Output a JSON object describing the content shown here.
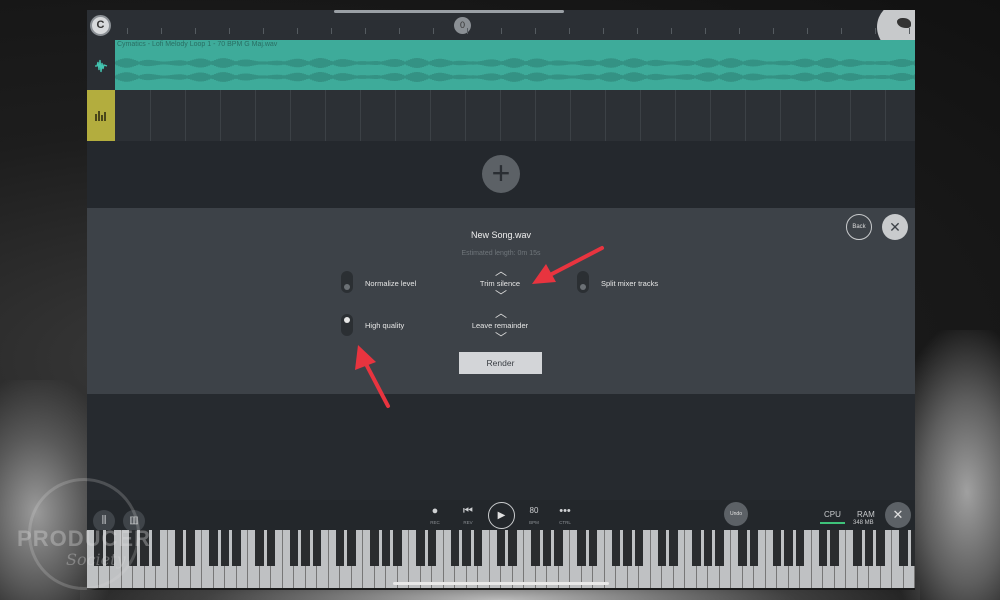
{
  "timeline": {
    "playhead_label": "0",
    "magnet_label": "C"
  },
  "tracks": {
    "audio_clip_title": "Cymatics - Lofi Melody Loop 1 - 70 BPM G Maj.wav"
  },
  "dialog": {
    "file_name": "New Song.wav",
    "estimated_length": "Estimated length: 0m 15s",
    "back_label": "Back",
    "close_glyph": "✕",
    "options": {
      "normalize_level": {
        "label": "Normalize level",
        "enabled": false
      },
      "high_quality": {
        "label": "High quality",
        "enabled": true
      },
      "split_mixer_tracks": {
        "label": "Split mixer tracks",
        "enabled": false
      }
    },
    "tail_modes": {
      "current": "Trim silence",
      "second": "Leave remainder"
    },
    "render_label": "Render"
  },
  "toolbar": {
    "rec_label": "REC",
    "rev_label": "REV",
    "bpm_value": "80",
    "bpm_label": "BPM",
    "ctrl_label": "CTRL",
    "undo_label": "Undo",
    "cpu_label": "CPU",
    "ram_label": "RAM",
    "ram_value": "348 MB",
    "close_glyph": "✕"
  },
  "watermark": {
    "line1": "PRODUCER",
    "line2": "Society"
  },
  "colors": {
    "audio_clip": "#3eab9a",
    "pattern_icon": "#b3ad3e",
    "dialog_bg": "#3d4248",
    "annotation_arrow": "#e8343f",
    "cpu_meter": "#3ec27a"
  }
}
